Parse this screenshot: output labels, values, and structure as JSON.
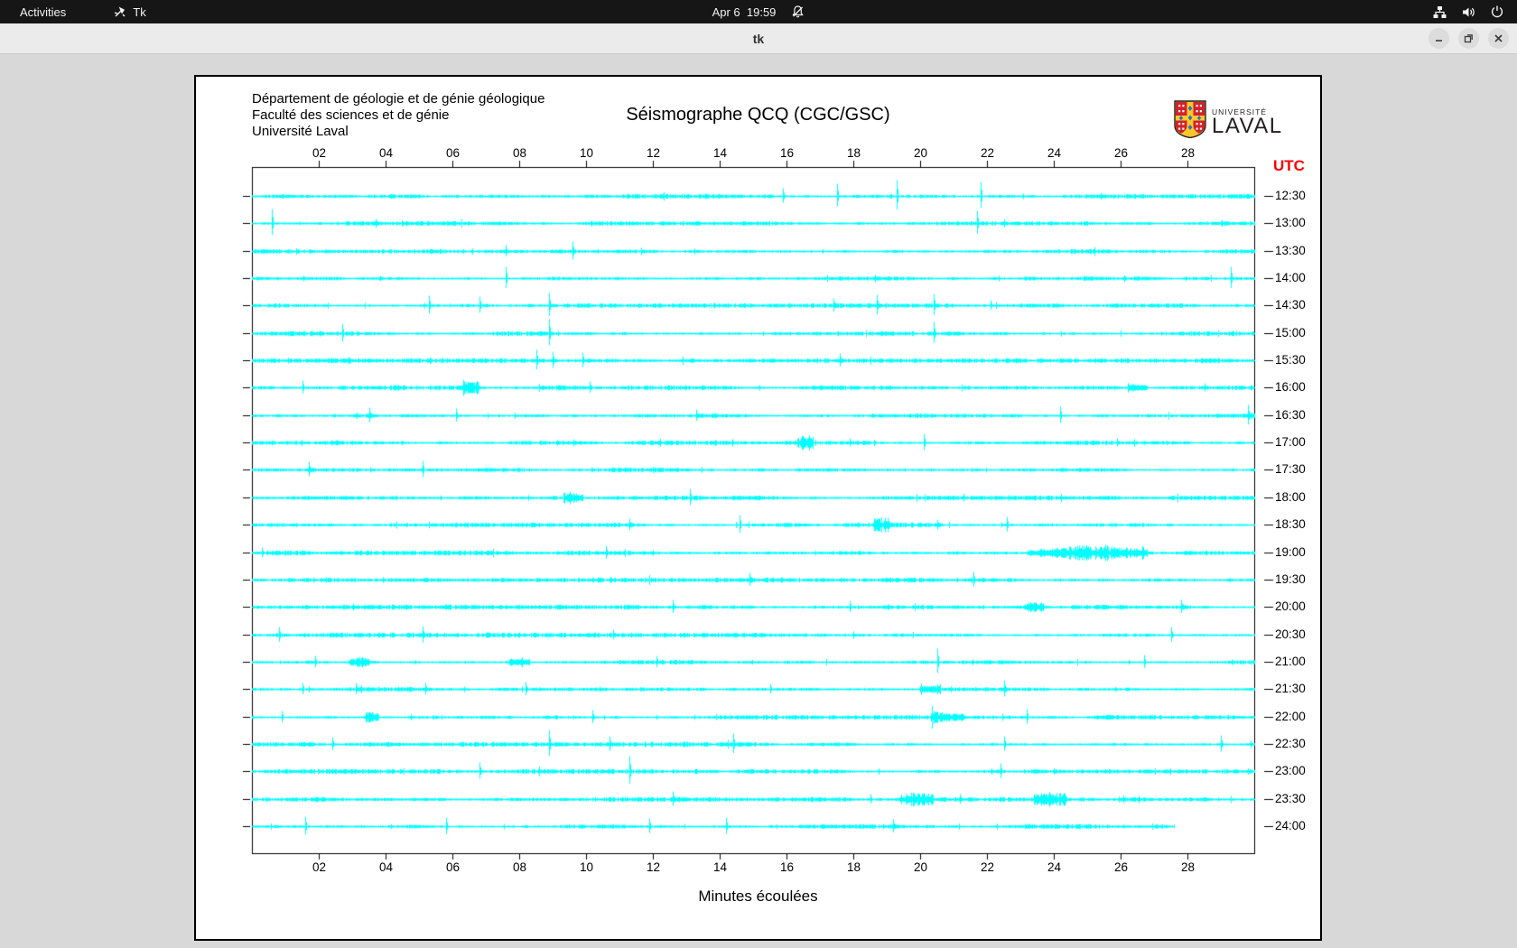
{
  "desktop": {
    "topbar": {
      "activities_label": "Activities",
      "app_indicator_label": "Tk",
      "clock": "Apr 6  19:59",
      "status_icons": [
        "network-wired-icon",
        "volume-icon",
        "power-icon"
      ]
    },
    "window": {
      "title": "tk",
      "controls": [
        "minimize",
        "maximize",
        "close"
      ]
    }
  },
  "app": {
    "header_lines": [
      "Département de géologie et de génie géologique",
      "Faculté des sciences et de génie",
      "Université Laval"
    ],
    "title": "Séismographe QCQ (CGC/GSC)",
    "logo": {
      "small_text": "UNIVERSITÉ",
      "large_text": "LAVAL",
      "red": "#d2232a",
      "gold": "#ffc72c",
      "blue": "#1f7ac3"
    },
    "footer": "Minutes écoulées"
  },
  "chart_data": {
    "type": "line",
    "title": "Séismographe QCQ (CGC/GSC)",
    "xlabel": "Minutes écoulées",
    "right_axis_label": "UTC",
    "x_range": [
      0,
      30
    ],
    "x_tick_minutes": [
      2,
      4,
      6,
      8,
      10,
      12,
      14,
      16,
      18,
      20,
      22,
      24,
      26,
      28
    ],
    "x_tick_labels": [
      "02",
      "04",
      "06",
      "08",
      "10",
      "12",
      "14",
      "16",
      "18",
      "20",
      "22",
      "24",
      "26",
      "28"
    ],
    "trace_color": "#00ffff",
    "rows": [
      {
        "time": "12:30",
        "events": [
          [
            15.9,
            9
          ],
          [
            17.5,
            14
          ],
          [
            19.3,
            18
          ],
          [
            21.8,
            16
          ]
        ],
        "bursts": [],
        "end": 30
      },
      {
        "time": "13:00",
        "events": [
          [
            0.6,
            16
          ],
          [
            21.7,
            14
          ]
        ],
        "bursts": [],
        "end": 30
      },
      {
        "time": "13:30",
        "events": [
          [
            7.6,
            7
          ],
          [
            9.6,
            11
          ]
        ],
        "bursts": [],
        "end": 30
      },
      {
        "time": "14:00",
        "events": [
          [
            7.6,
            13
          ],
          [
            29.3,
            13
          ]
        ],
        "bursts": [],
        "end": 30
      },
      {
        "time": "14:30",
        "events": [
          [
            5.3,
            11
          ],
          [
            6.8,
            10
          ],
          [
            8.9,
            14
          ],
          [
            17.4,
            8
          ],
          [
            18.7,
            12
          ],
          [
            20.4,
            13
          ],
          [
            22.1,
            6
          ]
        ],
        "bursts": [],
        "end": 30
      },
      {
        "time": "15:00",
        "events": [
          [
            2.7,
            11
          ],
          [
            8.9,
            16
          ],
          [
            20.4,
            13
          ]
        ],
        "bursts": [],
        "end": 30
      },
      {
        "time": "15:30",
        "events": [
          [
            8.5,
            12
          ],
          [
            9.0,
            10
          ],
          [
            9.9,
            9
          ],
          [
            17.6,
            8
          ]
        ],
        "bursts": [],
        "end": 30
      },
      {
        "time": "16:00",
        "events": [
          [
            1.5,
            8
          ],
          [
            6.6,
            5
          ],
          [
            10.1,
            7
          ],
          [
            28.5,
            5
          ]
        ],
        "bursts": [
          [
            6.3,
            6.8
          ],
          [
            26.2,
            26.8
          ]
        ],
        "end": 30
      },
      {
        "time": "16:30",
        "events": [
          [
            3.5,
            9
          ],
          [
            6.1,
            8
          ],
          [
            13.3,
            7
          ],
          [
            24.2,
            10
          ],
          [
            29.8,
            12
          ]
        ],
        "bursts": [],
        "end": 30
      },
      {
        "time": "17:00",
        "events": [
          [
            17.9,
            5
          ],
          [
            20.1,
            10
          ],
          [
            25.9,
            5
          ]
        ],
        "bursts": [
          [
            16.3,
            16.8
          ]
        ],
        "end": 30
      },
      {
        "time": "17:30",
        "events": [
          [
            1.7,
            9
          ],
          [
            5.1,
            10
          ]
        ],
        "bursts": [],
        "end": 30
      },
      {
        "time": "18:00",
        "events": [
          [
            13.1,
            10
          ],
          [
            21.3,
            5
          ]
        ],
        "bursts": [
          [
            9.3,
            9.9
          ]
        ],
        "end": 30
      },
      {
        "time": "18:30",
        "events": [
          [
            11.3,
            7
          ],
          [
            14.6,
            11
          ],
          [
            20.5,
            6
          ],
          [
            22.6,
            9
          ]
        ],
        "bursts": [
          [
            18.6,
            19.1
          ]
        ],
        "end": 30
      },
      {
        "time": "19:00",
        "events": [
          [
            0.3,
            6
          ],
          [
            10.6,
            8
          ],
          [
            24.5,
            5
          ],
          [
            25.5,
            6
          ]
        ],
        "bursts": [
          [
            23.2,
            26.8
          ]
        ],
        "end": 30
      },
      {
        "time": "19:30",
        "events": [
          [
            14.9,
            8
          ],
          [
            21.6,
            9
          ]
        ],
        "bursts": [],
        "end": 30
      },
      {
        "time": "20:00",
        "events": [
          [
            12.6,
            8
          ],
          [
            17.9,
            7
          ],
          [
            27.8,
            8
          ]
        ],
        "bursts": [
          [
            23.1,
            23.7
          ]
        ],
        "end": 30
      },
      {
        "time": "20:30",
        "events": [
          [
            0.8,
            9
          ],
          [
            5.1,
            10
          ],
          [
            10.8,
            6
          ],
          [
            27.5,
            9
          ]
        ],
        "bursts": [],
        "end": 30
      },
      {
        "time": "21:00",
        "events": [
          [
            1.9,
            7
          ],
          [
            12.1,
            7
          ],
          [
            20.5,
            15
          ],
          [
            26.7,
            8
          ]
        ],
        "bursts": [
          [
            2.9,
            3.5
          ],
          [
            7.7,
            8.3
          ]
        ],
        "end": 30
      },
      {
        "time": "21:30",
        "events": [
          [
            1.5,
            7
          ],
          [
            3.1,
            7
          ],
          [
            5.2,
            7
          ],
          [
            8.2,
            8
          ],
          [
            15.5,
            6
          ],
          [
            22.5,
            10
          ]
        ],
        "bursts": [
          [
            20.0,
            20.6
          ]
        ],
        "end": 30
      },
      {
        "time": "22:00",
        "events": [
          [
            0.9,
            7
          ],
          [
            3.6,
            6
          ],
          [
            10.2,
            8
          ],
          [
            23.2,
            9
          ]
        ],
        "bursts": [
          [
            3.4,
            3.8
          ],
          [
            20.3,
            21.3
          ]
        ],
        "end": 30
      },
      {
        "time": "22:30",
        "events": [
          [
            2.4,
            8
          ],
          [
            8.9,
            16
          ],
          [
            10.7,
            9
          ],
          [
            14.4,
            12
          ],
          [
            22.5,
            9
          ],
          [
            29.0,
            10
          ]
        ],
        "bursts": [],
        "end": 30
      },
      {
        "time": "23:00",
        "events": [
          [
            6.8,
            10
          ],
          [
            11.3,
            17
          ],
          [
            22.4,
            9
          ]
        ],
        "bursts": [],
        "end": 30
      },
      {
        "time": "23:30",
        "events": [
          [
            12.6,
            9
          ],
          [
            18.5,
            6
          ],
          [
            21.2,
            6
          ]
        ],
        "bursts": [
          [
            19.4,
            20.4
          ],
          [
            23.4,
            24.4
          ]
        ],
        "end": 30
      },
      {
        "time": "24:00",
        "events": [
          [
            1.6,
            11
          ],
          [
            5.8,
            10
          ],
          [
            11.9,
            9
          ],
          [
            14.2,
            10
          ],
          [
            19.2,
            8
          ]
        ],
        "bursts": [],
        "end": 27.6
      }
    ]
  }
}
